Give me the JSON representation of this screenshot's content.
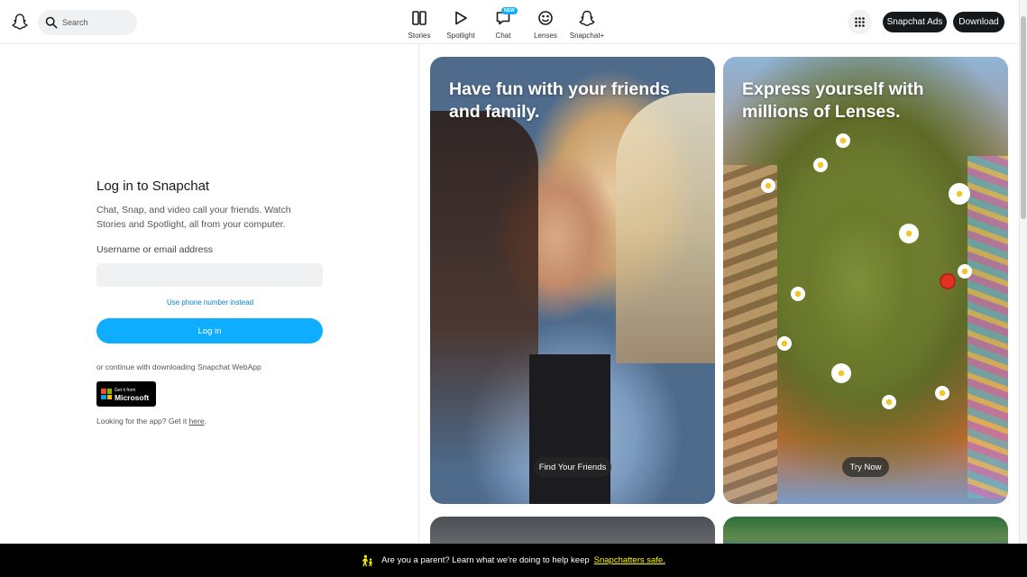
{
  "header": {
    "search_placeholder": "Search",
    "nav": [
      {
        "label": "Stories",
        "icon": "stories-icon"
      },
      {
        "label": "Spotlight",
        "icon": "spotlight-icon"
      },
      {
        "label": "Chat",
        "icon": "chat-icon",
        "badge": "NEW"
      },
      {
        "label": "Lenses",
        "icon": "lenses-icon"
      },
      {
        "label": "Snapchat+",
        "icon": "snapchat-plus-icon"
      }
    ],
    "ads_label": "Snapchat Ads",
    "download_label": "Download"
  },
  "login": {
    "title": "Log in to Snapchat",
    "description": "Chat, Snap, and video call your friends. Watch Stories and Spotlight, all from your computer.",
    "username_label": "Username or email address",
    "username_value": "",
    "phone_link": "Use phone number instead",
    "login_button": "Log in",
    "continue_text": "or continue with downloading Snapchat WebApp",
    "ms_badge_small": "Get it from",
    "ms_badge_big": "Microsoft",
    "looking_text": "Looking for the app? Get it ",
    "looking_link": "here",
    "looking_end": "."
  },
  "cards": [
    {
      "title": "Have fun with your friends and family.",
      "button": "Find Your Friends"
    },
    {
      "title": "Express yourself with millions of Lenses.",
      "button": "Try Now"
    }
  ],
  "banner": {
    "text": "Are you a parent? Learn what we're doing to help keep",
    "link": "Snapchatters safe."
  },
  "colors": {
    "accent": "#0fadff",
    "dark_button": "#16191c",
    "banner_link": "#fffc00"
  }
}
